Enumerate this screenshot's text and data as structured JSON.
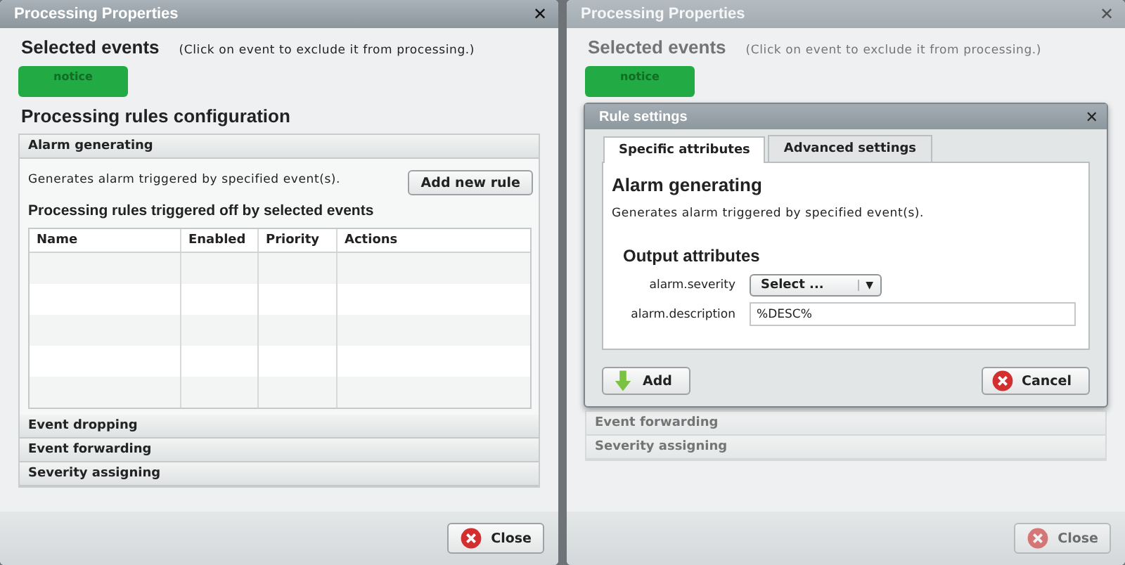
{
  "panels": [
    {
      "dimmed": false,
      "window": {
        "title": "Processing Properties",
        "close": "✕"
      },
      "selected_events": {
        "title": "Selected events",
        "hint": "(Click on event to exclude it from processing.)",
        "events": [
          {
            "label": "notice",
            "color": "#22aa44"
          }
        ]
      },
      "config_title": "Processing rules configuration",
      "sections": [
        {
          "title": "Alarm generating",
          "description": "Generates alarm triggered by specified event(s).",
          "button": "Add new rule",
          "table_title": "Processing rules triggered off by selected events",
          "columns": [
            "Name",
            "Enabled",
            "Priority",
            "Actions"
          ]
        },
        {
          "title": "Event dropping"
        },
        {
          "title": "Event forwarding"
        },
        {
          "title": "Severity assigning"
        }
      ],
      "footer_button": "Close"
    },
    {
      "dimmed": true,
      "window": {
        "title": "Processing Properties",
        "close": "✕"
      },
      "selected_events": {
        "title": "Selected events",
        "hint": "(Click on event to exclude it from processing.)",
        "events": [
          {
            "label": "notice",
            "color": "#22aa44"
          }
        ]
      },
      "dialog": {
        "title": "Rule settings",
        "close": "✕",
        "tabs": [
          {
            "label": "Specific attributes",
            "selected": true
          },
          {
            "label": "Advanced settings",
            "selected": false
          }
        ],
        "heading": "Alarm generating",
        "description": "Generates alarm triggered by specified event(s).",
        "output_title": "Output attributes",
        "fields": [
          {
            "kind": "select",
            "label": "alarm.severity",
            "value": "Select ...",
            "arrow": "▼"
          },
          {
            "kind": "text",
            "label": "alarm.description",
            "value": "%DESC%"
          }
        ],
        "buttons": [
          {
            "kind": "add",
            "label": "Add"
          },
          {
            "kind": "cancel",
            "label": "Cancel"
          }
        ]
      },
      "sections": [
        {
          "title": "Event forwarding"
        },
        {
          "title": "Severity assigning"
        }
      ],
      "footer_button": "Close"
    }
  ]
}
